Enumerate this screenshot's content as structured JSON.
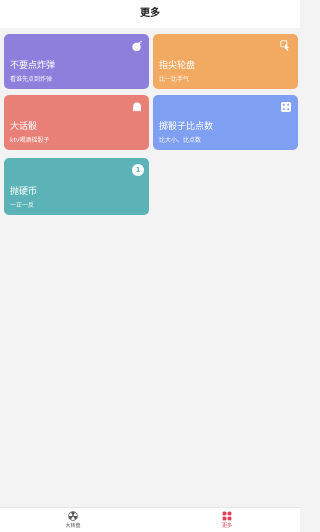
{
  "header": {
    "title": "更多"
  },
  "colors": {
    "purple": "#8f7fdc",
    "orange": "#f2aa62",
    "red": "#e98077",
    "blue": "#7f9ff2",
    "teal": "#5bb3b7",
    "tab_active": "#e04055",
    "tab_inactive": "#555555"
  },
  "cards": [
    {
      "title": "不要点炸弹",
      "subtitle": "看谁先点到炸弹",
      "icon": "bomb-icon"
    },
    {
      "title": "指尖轮盘",
      "subtitle": "比一比手气",
      "icon": "touch-icon"
    },
    {
      "title": "大话骰",
      "subtitle": "ktv喝酒摇骰子",
      "icon": "chat-icon"
    },
    {
      "title": "掷骰子比点数",
      "subtitle": "比大小、比点数",
      "icon": "dice-icon"
    },
    {
      "title": "抛硬币",
      "subtitle": "一正一反",
      "icon": "coin-icon",
      "badge": "1"
    }
  ],
  "tabbar": {
    "tabs": [
      {
        "label": "大转盘",
        "icon": "radiation-icon",
        "active": false
      },
      {
        "label": "更多",
        "icon": "grid-icon",
        "active": true
      }
    ]
  }
}
